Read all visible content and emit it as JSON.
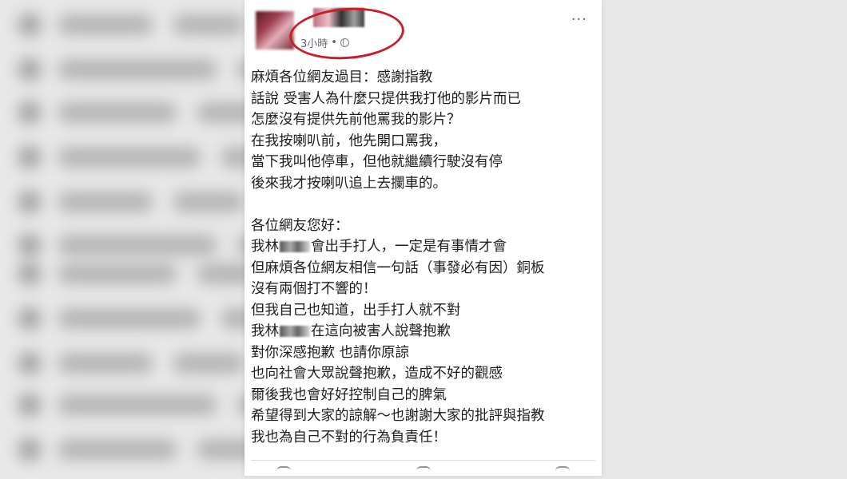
{
  "post": {
    "timestamp": "3小時",
    "separator": "•",
    "privacy_icon": "globe-icon",
    "more_icon": "more-options-icon",
    "annotation_color": "#c8202a",
    "lines": [
      "麻煩各位網友過目：感謝指教",
      "話說 受害人為什麼只提供我打他的影片而已",
      "怎麼沒有提供先前他罵我的影片？",
      "在我按喇叭前，他先開口罵我，",
      "當下我叫他停車，但他就繼續行駛沒有停",
      "後來我才按喇叭追上去攔車的。",
      "",
      "各位網友您好：",
      "我林|會出手打人，一定是有事情才會",
      "但麻煩各位網友相信一句話（事發必有因）銅板",
      "沒有兩個打不響的！",
      "但我自己也知道，出手打人就不對",
      "我林|在這向被害人說聲抱歉",
      "對你深感抱歉 也請你原諒",
      "也向社會大眾說聲抱歉，造成不好的觀感",
      "爾後我也會好好控制自己的脾氣",
      "希望得到大家的諒解～也謝謝大家的批評與指教",
      "我也為自己不對的行為負責任！"
    ],
    "actions": [
      "like-icon",
      "comment-icon",
      "share-icon"
    ]
  }
}
